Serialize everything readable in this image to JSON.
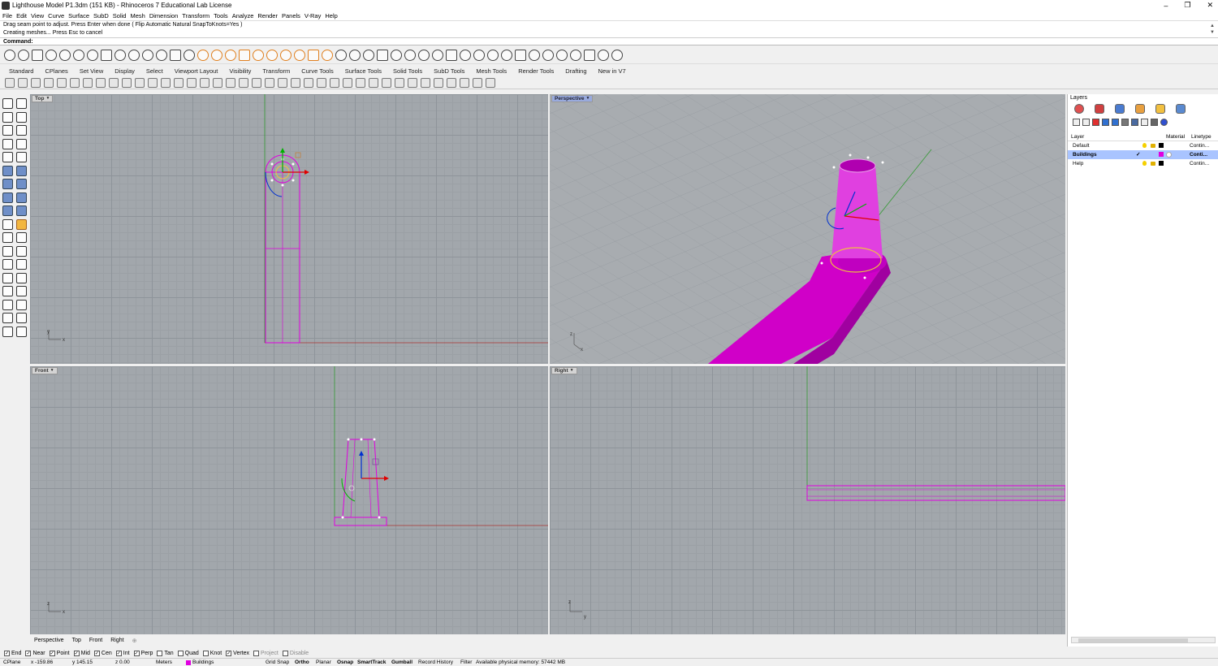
{
  "window": {
    "title": "Lighthouse Model P1.3dm (151 KB) - Rhinoceros 7 Educational Lab License",
    "minimize": "–",
    "restore": "❐",
    "close": "✕"
  },
  "menu": [
    "File",
    "Edit",
    "View",
    "Curve",
    "Surface",
    "SubD",
    "Solid",
    "Mesh",
    "Dimension",
    "Transform",
    "Tools",
    "Analyze",
    "Render",
    "Panels",
    "V-Ray",
    "Help"
  ],
  "command": {
    "history1": "Drag seam point to adjust. Press Enter when done ( Flip  Automatic  Natural  SnapToKnots=Yes )",
    "history2": "Creating meshes... Press Esc to cancel",
    "prompt": "Command:"
  },
  "tabs": [
    "Standard",
    "CPlanes",
    "Set View",
    "Display",
    "Select",
    "Viewport Layout",
    "Visibility",
    "Transform",
    "Curve Tools",
    "Surface Tools",
    "Solid Tools",
    "SubD Tools",
    "Mesh Tools",
    "Render Tools",
    "Drafting",
    "New in V7"
  ],
  "viewports": {
    "top": {
      "label": "Top"
    },
    "perspective": {
      "label": "Perspective"
    },
    "front": {
      "label": "Front"
    },
    "right": {
      "label": "Right"
    }
  },
  "axes": {
    "x": "x",
    "y": "y",
    "z": "z"
  },
  "colors": {
    "selection": "#e000e0",
    "x_axis": "#a33",
    "y_axis": "#393",
    "gumball_x": "#e00000",
    "gumball_y": "#00b000",
    "gumball_z": "#0030d0"
  },
  "layers": {
    "title": "Layers",
    "col_layer": "Layer",
    "col_material": "Material",
    "col_linetype": "Linetype",
    "rows": [
      {
        "name": "Default",
        "linetype": "Contin...",
        "color": "#000000"
      },
      {
        "name": "Buildings",
        "linetype": "Conti...",
        "color": "#e000e0",
        "check": "✓"
      },
      {
        "name": "Help",
        "linetype": "Contin...",
        "color": "#000000"
      }
    ]
  },
  "viewport_tabs": [
    "Perspective",
    "Top",
    "Front",
    "Right"
  ],
  "viewport_tabs_add": "⊕",
  "osnaps": [
    {
      "label": "End",
      "checked": "✓"
    },
    {
      "label": "Near",
      "checked": "✓"
    },
    {
      "label": "Point",
      "checked": "✓"
    },
    {
      "label": "Mid",
      "checked": "✓"
    },
    {
      "label": "Cen",
      "checked": "✓"
    },
    {
      "label": "Int",
      "checked": "✓"
    },
    {
      "label": "Perp",
      "checked": "✓"
    },
    {
      "label": "Tan",
      "checked": ""
    },
    {
      "label": "Quad",
      "checked": ""
    },
    {
      "label": "Knot",
      "checked": ""
    },
    {
      "label": "Vertex",
      "checked": "✓"
    },
    {
      "label": "Project",
      "checked": ""
    },
    {
      "label": "Disable",
      "checked": ""
    }
  ],
  "status": {
    "cplane": "CPlane",
    "x": "x -159.86",
    "y": "y 145.15",
    "z": "z 0.00",
    "units": "Meters",
    "layer": "Buildings",
    "grid_snap": "Grid Snap",
    "ortho": "Ortho",
    "planar": "Planar",
    "osnap": "Osnap",
    "smarttrack": "SmartTrack",
    "gumball": "Gumball",
    "record_history": "Record History",
    "filter": "Filter",
    "memory": "Available physical memory: 57442 MB"
  }
}
